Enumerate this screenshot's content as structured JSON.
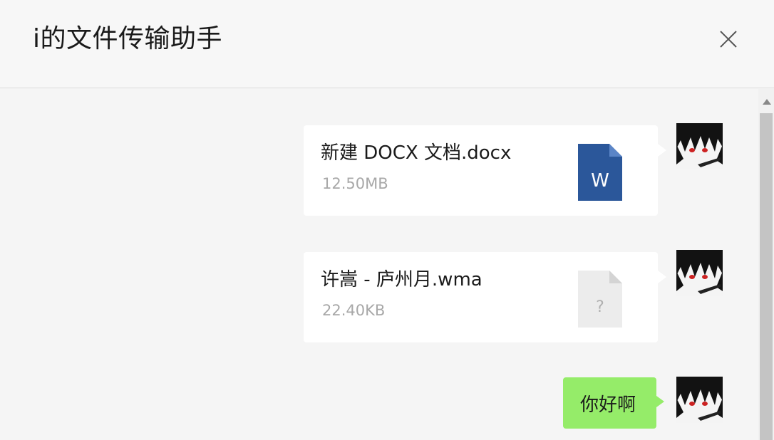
{
  "window": {
    "title": "i的文件传输助手",
    "close_icon": "close-icon"
  },
  "messages": [
    {
      "type": "file",
      "name": "新建 DOCX 文档.docx",
      "size": "12.50MB",
      "icon": "word-file-icon",
      "icon_letter": "W",
      "icon_color": "#2b579a"
    },
    {
      "type": "file",
      "name": "许嵩 - 庐州月.wma",
      "size": "22.40KB",
      "icon": "unknown-file-icon",
      "icon_letter": "?",
      "icon_color": "#ececec"
    },
    {
      "type": "text",
      "text": "你好啊",
      "bubble_color": "#95ec69"
    }
  ],
  "colors": {
    "chat_background": "#f5f5f5",
    "titlebar_background": "#f7f7f7",
    "sent_bubble": "#95ec69"
  }
}
